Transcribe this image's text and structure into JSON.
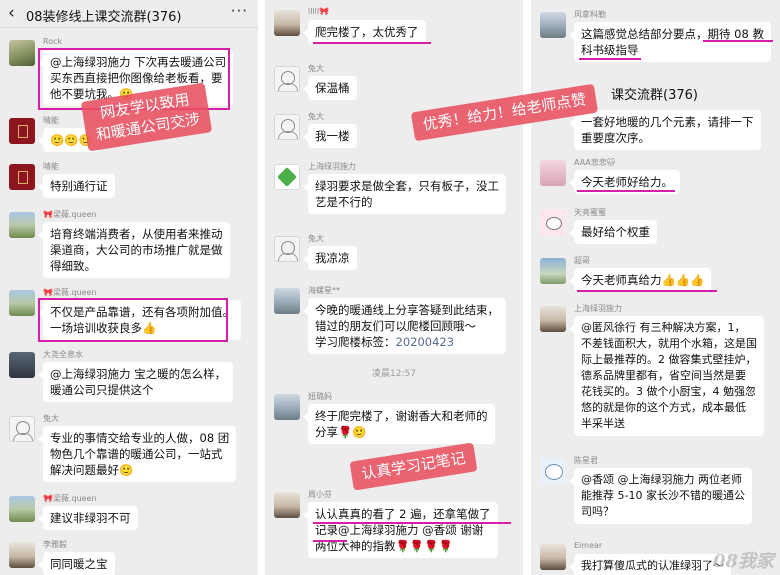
{
  "left": {
    "back_icon": "back-chevron-icon",
    "title": "08装修线上课交流群(376)",
    "more": "···",
    "messages": [
      {
        "sender": "Rock",
        "lines": [
          "@上海绿羽施力  下次再去暖通公司",
          "买东西直接把你图像给老板看，要",
          "他不要坑我。🙂"
        ]
      },
      {
        "sender": "晴能",
        "lines": [
          "🙂🙂🙂"
        ]
      },
      {
        "sender": "晴能",
        "lines": [
          "特别通行证"
        ]
      },
      {
        "sender": "🎀梁薇.queen",
        "lines": [
          "培育终端消费者，从使用者来推动",
          "渠道商，大公司的市场推广就是做",
          "得细致。"
        ]
      },
      {
        "sender": "🎀梁薇.queen",
        "lines": [
          "不仅是产品靠谱，还有各项附加值。",
          "一场培训收获良多👍"
        ]
      },
      {
        "sender": "大尧全息水",
        "lines": [
          "@上海绿羽施力  宝之暖的怎么样，",
          "暖通公司只提供这个"
        ]
      },
      {
        "sender": "兔大",
        "lines": [
          "专业的事情交给专业的人做，08 团",
          "物色几个靠谱的暖通公司，一站式",
          "解决问题最好🙂"
        ]
      },
      {
        "sender": "🎀梁薇.queen",
        "lines": [
          "建议非绿羽不可"
        ]
      },
      {
        "sender": "李雅毅",
        "lines": [
          "同同暖之宝"
        ]
      }
    ],
    "stamp": [
      "网友学以致用",
      "和暖通公司交涉"
    ]
  },
  "middle": {
    "messages": [
      {
        "sender": "lllll🎀",
        "lines": [
          "爬完楼了，太优秀了"
        ]
      },
      {
        "sender": "兔大",
        "lines": [
          "保温桶"
        ]
      },
      {
        "sender": "兔大",
        "lines": [
          "我一楼"
        ]
      },
      {
        "sender": "上海绿羽施力",
        "lines": [
          "绿羽要求是做全套，只有板子，没工",
          "艺是不行的"
        ]
      },
      {
        "sender": "兔大",
        "lines": [
          "我凉凉"
        ]
      },
      {
        "sender": "海螺星**",
        "lines": [
          "今晚的暖通线上分享答疑到此结束，",
          "错过的朋友们可以爬楼回顾哦～",
          "学习爬楼标签：20200423"
        ]
      },
      {
        "sender": "妞璐妈",
        "lines": [
          "终于爬完楼了，谢谢香大和老师的",
          "分享🌹🙂"
        ]
      },
      {
        "sender": "周小芬",
        "lines": [
          "认认真真的看了 2 遍，还拿笔做了",
          "记录@上海绿羽施力  @香颂  谢谢",
          "两位大神的指教🌹🌹🌹🌹"
        ]
      }
    ],
    "time_divider": "凌晨12:57",
    "link_text": "20200423",
    "stamp": "认真学习记笔记",
    "stamp_top": "优秀！给力！给老师点赞"
  },
  "right": {
    "title_fragment": "课交流群(376)",
    "messages": [
      {
        "sender": "风拿科勒",
        "lines": [
          "这篇感觉总结部分要点，期待 08 教",
          "科书级指导"
        ]
      },
      {
        "sender": "",
        "lines": [
          "一套好地暖的几个元素，请排一下",
          "重要度次序。"
        ]
      },
      {
        "sender": "AAA悲悲🐱",
        "lines": [
          "今天老师好给力。"
        ]
      },
      {
        "sender": "天亮蜜蜜",
        "lines": [
          "最好给个权重"
        ]
      },
      {
        "sender": "超哥",
        "lines": [
          "今天老师真给力👍👍👍"
        ]
      },
      {
        "sender": "上海绿羽施力",
        "lines": [
          "@匿风徐行  有三种解决方案，1，",
          "不差钱面积大，就用个水箱，这是国",
          "际上最推荐的。2 做容集式壁挂炉，",
          "德系品牌里都有，省空间当然是要",
          "花钱买的。3 做个小厨宝，4 勉强忽",
          "悠的就是你的这个方式，成本最低",
          "半采半送"
        ]
      },
      {
        "sender": "陈星君",
        "lines": [
          "@香颂  @上海绿羽施力  两位老师",
          "能推荐 5-10 家长沙不错的暖通公",
          "司吗？"
        ]
      },
      {
        "sender": "Eimear",
        "lines": [
          "我打算傻瓜式的认准绿羽了～"
        ]
      }
    ],
    "watermark": "08我家"
  }
}
